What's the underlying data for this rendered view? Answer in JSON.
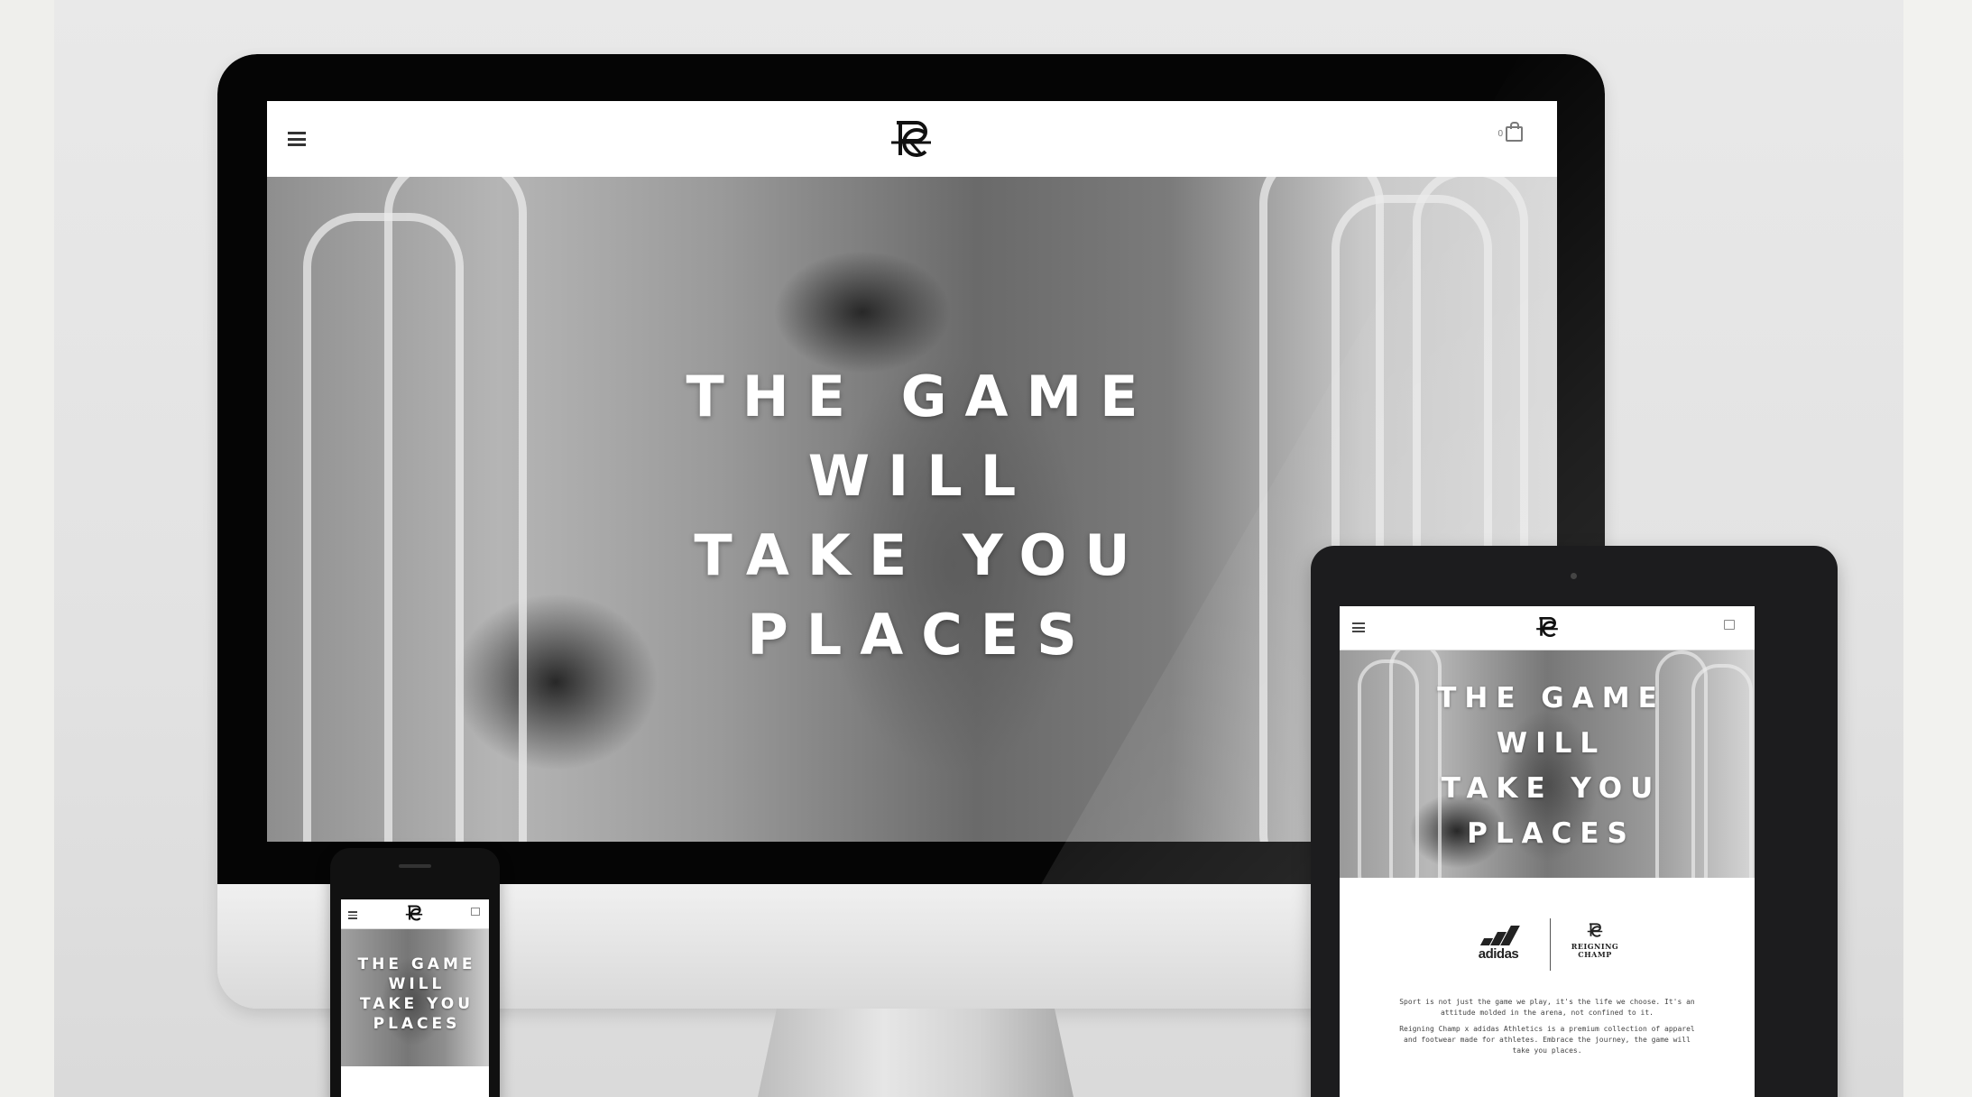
{
  "site": {
    "brand": "Reigning Champ",
    "cart_count": "0",
    "hero_lines": [
      "THE GAME",
      "WILL",
      "TAKE YOU",
      "PLACES"
    ]
  },
  "tablet": {
    "partner_logo_word": "adidas",
    "rc_wordmark_line1": "REIGNING",
    "rc_wordmark_line2": "CHAMP",
    "copy_p1": "Sport is not just the game we play, it's the life we choose. It's an attitude molded in the arena, not confined to it.",
    "copy_p2": "Reigning Champ x adidas Athletics is a premium collection of apparel and footwear made for athletes. Embrace the journey, the game will take you places."
  },
  "icons": [
    "menu-icon",
    "rc-logo-icon",
    "shopping-bag-icon",
    "adidas-logo-icon"
  ],
  "colors": {
    "bezel": "#050505",
    "page_bg": "#ffffff",
    "hero_text": "#ffffff"
  }
}
